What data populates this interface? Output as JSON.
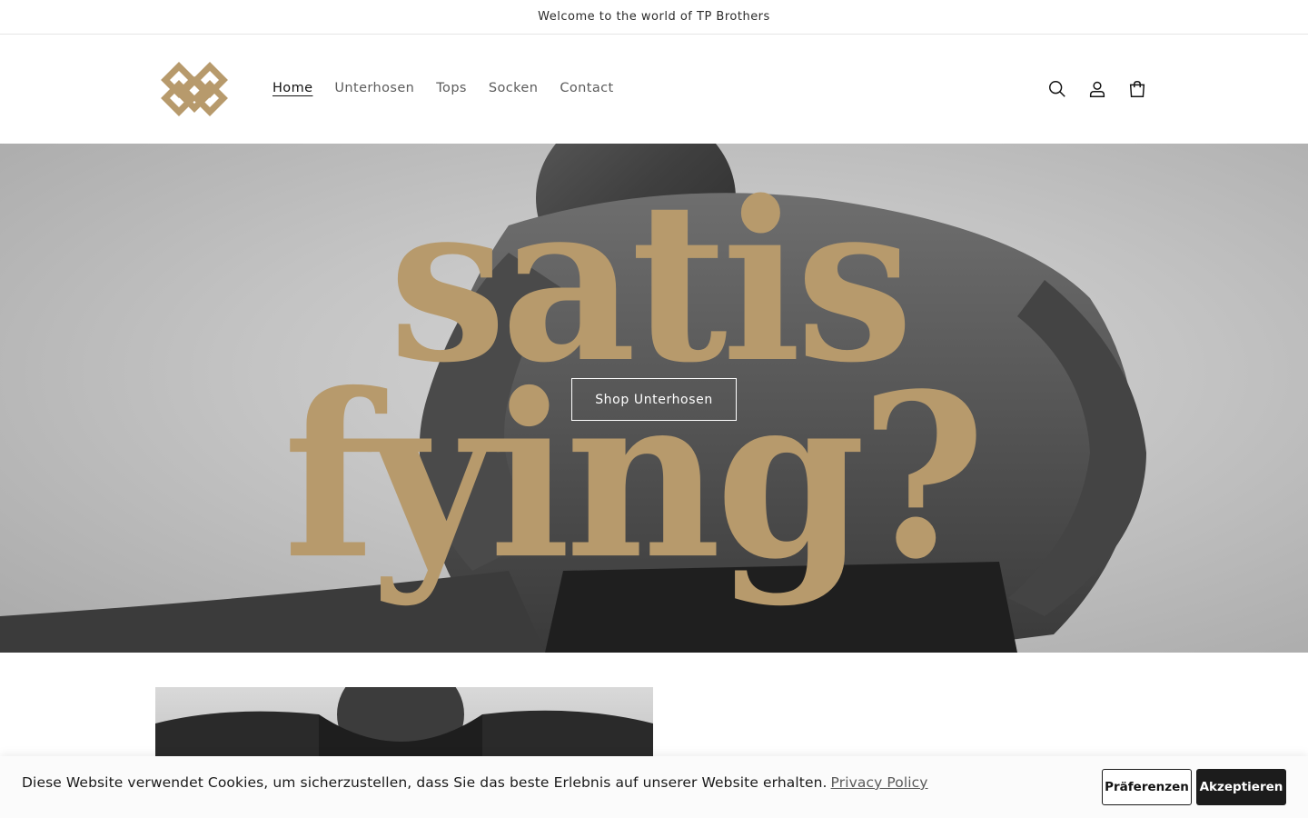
{
  "announcement": {
    "text": "Welcome to the world of TP Brothers"
  },
  "header": {
    "logo_icon": "tp-brothers-logo-icon",
    "nav": [
      {
        "label": "Home",
        "active": true
      },
      {
        "label": "Unterhosen",
        "active": false
      },
      {
        "label": "Tops",
        "active": false
      },
      {
        "label": "Socken",
        "active": false
      },
      {
        "label": "Contact",
        "active": false
      }
    ],
    "icons": [
      "search-icon",
      "account-icon",
      "cart-icon"
    ]
  },
  "hero": {
    "headline_line1": "satis",
    "headline_line2": "fying?",
    "cta_label": "Shop Unterhosen"
  },
  "cookie_banner": {
    "text": "Diese Website verwendet Cookies, um sicherzustellen, dass Sie das beste Erlebnis auf unserer Website erhalten.",
    "link_label": "Privacy Policy",
    "preferences_label": "Präferenzen",
    "accept_label": "Akzeptieren"
  },
  "colors": {
    "brand_gold": "#b79a6c",
    "text_dark": "#121212",
    "accept_button_bg": "#1c1c1c"
  }
}
